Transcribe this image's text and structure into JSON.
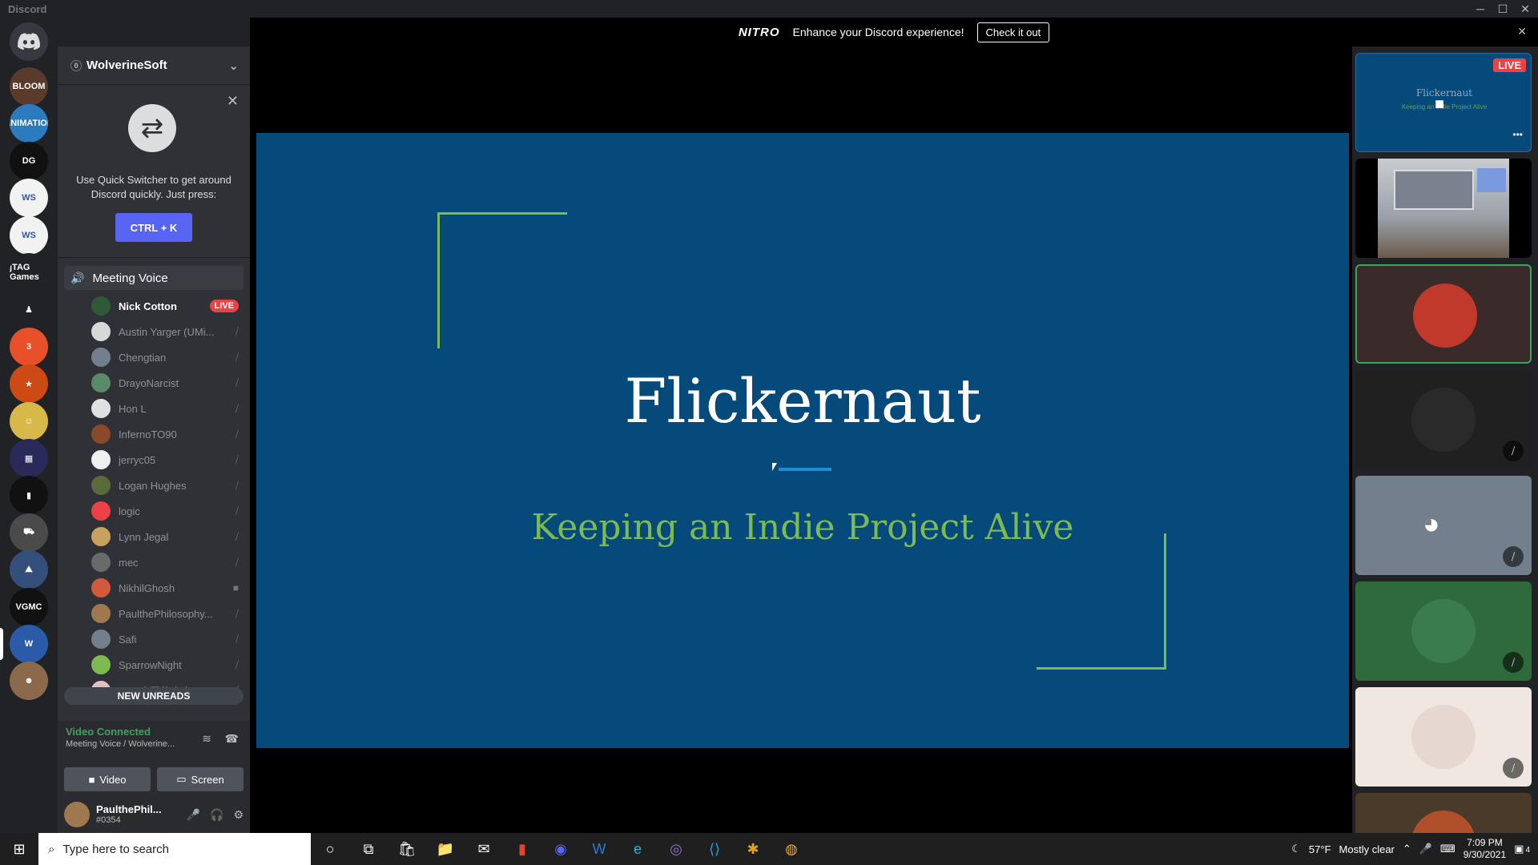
{
  "window": {
    "title": "Discord",
    "minimize": "─",
    "maximize": "☐",
    "close": "✕"
  },
  "nitro": {
    "logo": "NITRO",
    "message": "Enhance your Discord experience!",
    "cta": "Check it out",
    "close": "✕"
  },
  "guilds": {
    "home_icon": "discord-home-icon",
    "items": [
      {
        "label": "BLOOM",
        "color": "#5a3a2a"
      },
      {
        "label": "ANIMATION",
        "color": "#2c7bbf"
      },
      {
        "label": "DG",
        "color": "#111111"
      },
      {
        "label": "WS",
        "color": "#f2f2f2"
      },
      {
        "label": "WS",
        "color": "#f2f2f2"
      },
      {
        "label": "jTAG Games",
        "color": "#202225"
      },
      {
        "label": "♟",
        "color": "#202225"
      },
      {
        "label": "3",
        "color": "#e8502a"
      },
      {
        "label": "★",
        "color": "#cc4a14"
      },
      {
        "label": "☺",
        "color": "#d9b84a"
      },
      {
        "label": "▦",
        "color": "#2a2a5a"
      },
      {
        "label": "▮",
        "color": "#111111"
      },
      {
        "label": "⛟",
        "color": "#4a4a4a"
      },
      {
        "label": "⛰",
        "color": "#34507a"
      },
      {
        "label": "VGMC",
        "color": "#111111"
      },
      {
        "label": "W",
        "color": "#2b5aa8"
      },
      {
        "label": "☻",
        "color": "#8a6a4a"
      }
    ]
  },
  "server": {
    "name": "WolverineSoft",
    "dot_label": "0",
    "chevron": "⌄"
  },
  "quick_switcher": {
    "text": "Use Quick Switcher to get around Discord quickly. Just press:",
    "button": "CTRL + K",
    "close": "✕",
    "icon": "⇄"
  },
  "voice_channel": {
    "name": "Meeting Voice",
    "icon": "speaker-icon"
  },
  "voice_users": [
    {
      "name": "Nick Cotton",
      "status": "LIVE",
      "avatar_color": "#2f5a3a"
    },
    {
      "name": "Austin Yarger (UMi...",
      "status": "muted",
      "avatar_color": "#d8d8d8"
    },
    {
      "name": "Chengtian",
      "status": "muted",
      "avatar_color": "#747f8d"
    },
    {
      "name": "DrayoNarcist",
      "status": "muted",
      "avatar_color": "#5a8a6a"
    },
    {
      "name": "Hon L",
      "status": "muted",
      "avatar_color": "#e0e0e0"
    },
    {
      "name": "InfernoTO90",
      "status": "muted",
      "avatar_color": "#8a4a2a"
    },
    {
      "name": "jerryc05",
      "status": "muted",
      "avatar_color": "#f0f0f0"
    },
    {
      "name": "Logan Hughes",
      "status": "muted",
      "avatar_color": "#5a6a3a"
    },
    {
      "name": "logic",
      "status": "muted",
      "avatar_color": "#ed4245"
    },
    {
      "name": "Lynn Jegal",
      "status": "muted",
      "avatar_color": "#c8a060"
    },
    {
      "name": "mec",
      "status": "muted",
      "avatar_color": "#6a6a6a"
    },
    {
      "name": "NikhilGhosh",
      "status": "video",
      "avatar_color": "#d05a3a"
    },
    {
      "name": "PaulthePhilosophy...",
      "status": "muted",
      "avatar_color": "#a07850"
    },
    {
      "name": "Safi",
      "status": "muted",
      "avatar_color": "#747f8d"
    },
    {
      "name": "SparrowNight",
      "status": "muted",
      "avatar_color": "#7dbb52"
    },
    {
      "name": "不可磨灭的毒夫 (G...",
      "status": "muted",
      "avatar_color": "#e0c0c0"
    }
  ],
  "new_unreads": "NEW UNREADS",
  "voice_connection": {
    "status": "Video Connected",
    "location": "Meeting Voice / Wolverine...",
    "video": "Video",
    "screen": "Screen"
  },
  "user": {
    "name": "PaulthePhil...",
    "tag": "#0354"
  },
  "slide": {
    "title": "Flickernaut",
    "subtitle": "Keeping an Indie Project Alive"
  },
  "tiles": [
    {
      "type": "stream",
      "badge": "LIVE",
      "preview_title": "Flickernaut",
      "preview_sub": "Keeping an Indie Project Alive",
      "more": "•••"
    },
    {
      "type": "camera"
    },
    {
      "type": "avatar",
      "color": "#c0392b",
      "speaking": true
    },
    {
      "type": "avatar",
      "color": "#2a2a2a",
      "muted": true
    },
    {
      "type": "discord",
      "muted": true
    },
    {
      "type": "avatar",
      "color": "#3b7d4a",
      "muted": true
    },
    {
      "type": "avatar",
      "color": "#e6d8d0",
      "muted": true
    },
    {
      "type": "avatar",
      "color": "#b0502a"
    }
  ],
  "taskbar": {
    "search_placeholder": "Type here to search",
    "weather": "57°F",
    "weather_text": "Mostly clear",
    "time": "7:09 PM",
    "date": "9/30/2021",
    "notifications": "4"
  }
}
